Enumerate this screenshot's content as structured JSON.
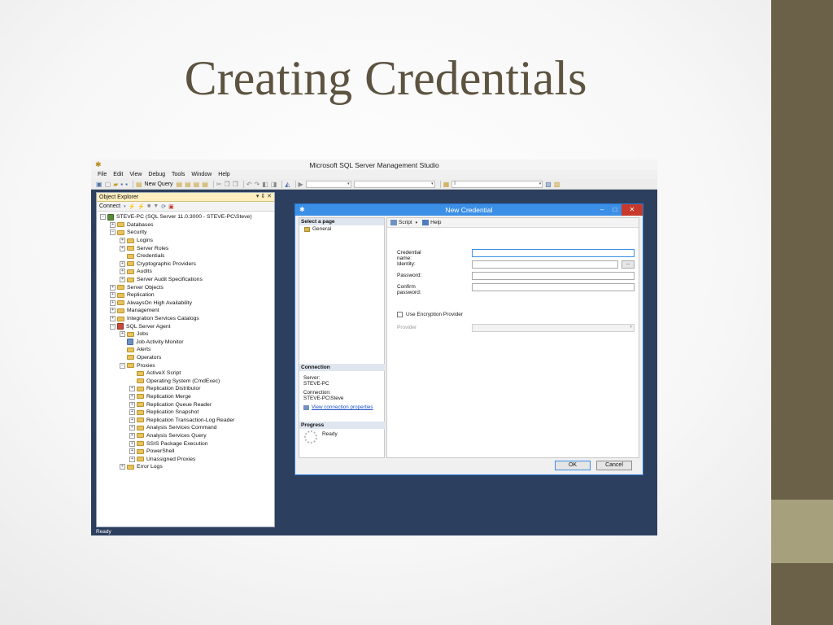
{
  "slide": {
    "title": "Creating Credentials",
    "accent_color": "#6b6148",
    "accent_light": "#a7a07c"
  },
  "ssms": {
    "window_title": "Microsoft SQL Server Management Studio",
    "menu": [
      "File",
      "Edit",
      "View",
      "Debug",
      "Tools",
      "Window",
      "Help"
    ],
    "toolbar": {
      "new_query_label": "New Query",
      "database_combo_value": "",
      "search_combo_value": "I"
    },
    "status": "Ready"
  },
  "object_explorer": {
    "title": "Object Explorer",
    "header_buttons": "▾ ⇕ ✕",
    "connect_label": "Connect",
    "server_node": "STEVE-PC (SQL Server 11.0.3000 - STEVE-PC\\Steve)",
    "nodes": {
      "databases": "Databases",
      "security": "Security",
      "logins": "Logins",
      "server_roles": "Server Roles",
      "credentials": "Credentials",
      "cryptographic_providers": "Cryptographic Providers",
      "audits": "Audits",
      "server_audit_specifications": "Server Audit Specifications",
      "server_objects": "Server Objects",
      "replication": "Replication",
      "alwayson": "AlwaysOn High Availability",
      "management": "Management",
      "integration_services_catalogs": "Integration Services Catalogs",
      "sql_server_agent": "SQL Server Agent",
      "jobs": "Jobs",
      "job_activity_monitor": "Job Activity Monitor",
      "alerts": "Alerts",
      "operators": "Operators",
      "proxies": "Proxies",
      "activex_script": "ActiveX Script",
      "operating_system": "Operating System (CmdExec)",
      "replication_distributor": "Replication Distributor",
      "replication_merge": "Replication Merge",
      "replication_queue_reader": "Replication Queue Reader",
      "replication_snapshot": "Replication Snapshot",
      "replication_transaction_log_reader": "Replication Transaction-Log Reader",
      "analysis_services_command": "Analysis Services Command",
      "analysis_services_query": "Analysis Services Query",
      "ssis_package_execution": "SSIS Package Execution",
      "powershell": "PowerShell",
      "unassigned_proxies": "Unassigned Proxies",
      "error_logs": "Error Logs"
    }
  },
  "dialog": {
    "title": "New Credential",
    "select_page_header": "Select a page",
    "pages": [
      "General"
    ],
    "toolbar": {
      "script_label": "Script",
      "help_label": "Help"
    },
    "fields": {
      "credential_name_label": "Credential name:",
      "identity_label": "Identity:",
      "password_label": "Password:",
      "confirm_password_label": "Confirm password:",
      "ellipsis_label": "...",
      "use_encryption_label": "Use Encryption Provider",
      "provider_label": "Provider"
    },
    "connection": {
      "header": "Connection",
      "server_label": "Server:",
      "server_value": "STEVE-PC",
      "connection_label": "Connection:",
      "connection_value": "STEVE-PC\\Steve",
      "view_properties_link": "View connection properties"
    },
    "progress": {
      "header": "Progress",
      "status": "Ready"
    },
    "buttons": {
      "ok": "OK",
      "cancel": "Cancel"
    }
  }
}
